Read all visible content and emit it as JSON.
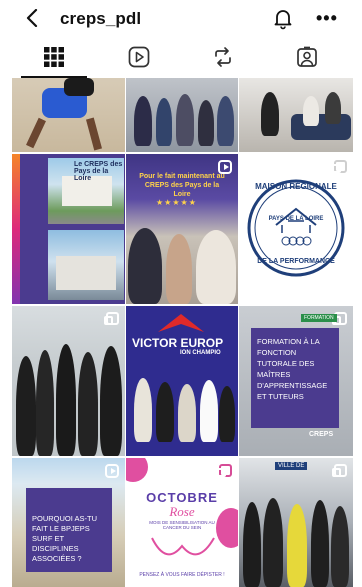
{
  "header": {
    "username": "creps_pdl"
  },
  "tabs": [
    {
      "name": "grid",
      "active": true
    },
    {
      "name": "reels",
      "active": false
    },
    {
      "name": "reposts",
      "active": false
    },
    {
      "name": "tagged",
      "active": false
    }
  ],
  "posts": {
    "p4_text": "Le CREPS des Pays de la Loire",
    "p5_text": "Pour le fait maintenant au CREPS des Pays de la Loire",
    "p6_seal_top": "MAISON RÉGIONALE",
    "p6_seal_mid": "PAYS DE LA LOIRE",
    "p6_seal_bottom": "DE LA PERFORMANCE",
    "p8_text": "VICTOR EUROP",
    "p8_sub": "ION CHAMPIO",
    "p9_tag": "FORMATION",
    "p9_text": "FORMATION À LA FONCTION TUTORALE DES MAÎTRES D'APPRENTISSAGE ET TUTEURS",
    "p9_brand": "CREPS",
    "p10_text": "POURQUOI AS-TU FAIT LE BPJEPS SURF ET DISCIPLINES ASSOCIÉES ?",
    "p11_title": "OCTOBRE",
    "p11_script": "Rose",
    "p11_sub": "MOIS DE SENSIBILISATION AU CANCER DU SEIN",
    "p11_footer": "PENSEZ À VOUS FAIRE DÉPISTER !",
    "p12_sign": "VILLE DE"
  },
  "colors": {
    "purple": "#4b3b8f",
    "pink": "#e04fa0",
    "seal_blue": "#1f3f7a"
  }
}
